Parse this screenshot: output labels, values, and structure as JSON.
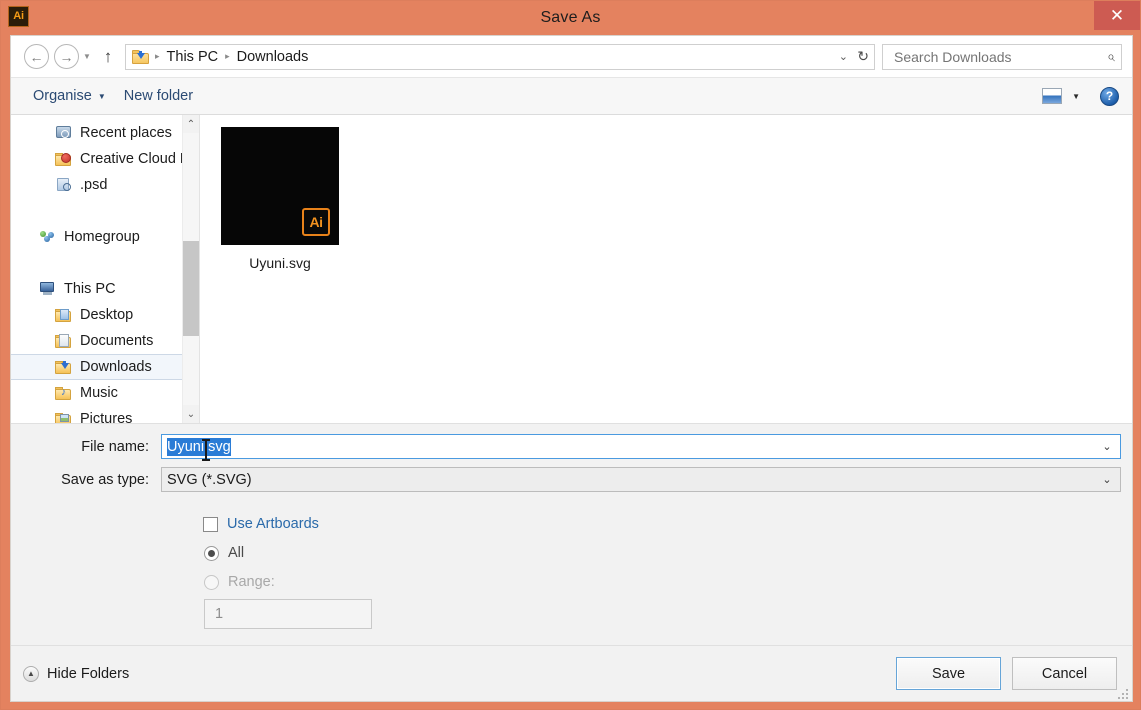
{
  "window": {
    "title": "Save As",
    "app_icon_label": "Ai",
    "close_label": "✕",
    "accent_color": "#e4825f",
    "close_button_color": "#cd5b52"
  },
  "navbar": {
    "back_icon": "←",
    "forward_icon": "→",
    "history_caret": "▼",
    "up_icon": "↑",
    "breadcrumb": {
      "items": [
        "This PC",
        "Downloads"
      ],
      "separator": "▸",
      "expand_caret": "⌄",
      "refresh_icon": "↻"
    },
    "search": {
      "placeholder": "Search Downloads",
      "value": "",
      "icon": "⌕"
    }
  },
  "command_bar": {
    "organise_label": "Organise",
    "organise_caret": "▼",
    "new_folder_label": "New folder",
    "view_caret": "▼",
    "help_label": "?"
  },
  "sidebar": {
    "items": [
      {
        "label": "Recent places",
        "icon": "recent-places-icon",
        "indent": true,
        "selected": false
      },
      {
        "label": "Creative Cloud File",
        "icon": "creative-cloud-files-icon",
        "indent": true,
        "selected": false
      },
      {
        "label": ".psd",
        "icon": "psd-search-icon",
        "indent": true,
        "selected": false
      },
      {
        "label": "Homegroup",
        "icon": "homegroup-icon",
        "indent": false,
        "selected": false
      },
      {
        "label": "This PC",
        "icon": "this-pc-icon",
        "indent": false,
        "selected": false
      },
      {
        "label": "Desktop",
        "icon": "desktop-folder-icon",
        "indent": true,
        "selected": false
      },
      {
        "label": "Documents",
        "icon": "documents-folder-icon",
        "indent": true,
        "selected": false
      },
      {
        "label": "Downloads",
        "icon": "downloads-folder-icon",
        "indent": true,
        "selected": true
      },
      {
        "label": "Music",
        "icon": "music-folder-icon",
        "indent": true,
        "selected": false
      },
      {
        "label": "Pictures",
        "icon": "pictures-folder-icon",
        "indent": true,
        "selected": false
      }
    ],
    "scrollbar": {
      "up_arrow": "⌃",
      "down_arrow": "⌄"
    }
  },
  "file_list": {
    "files": [
      {
        "name": "Uyuni.svg",
        "thumbnail_color": "#060606",
        "badge_label": "Ai",
        "badge_color": "#e8821a"
      }
    ]
  },
  "form": {
    "file_name": {
      "label": "File name:",
      "value": "Uyuni.svg",
      "selected": true,
      "caret": "⌄"
    },
    "save_as_type": {
      "label": "Save as type:",
      "value": "SVG (*.SVG)",
      "caret": "⌄"
    }
  },
  "options": {
    "use_artboards": {
      "label": "Use Artboards",
      "checked": false
    },
    "all": {
      "label": "All",
      "selected": true
    },
    "range": {
      "label": "Range:",
      "selected": false,
      "disabled": true,
      "value": "1"
    }
  },
  "footer": {
    "hide_folders_label": "Hide Folders",
    "hide_folders_icon": "▲",
    "save_label": "Save",
    "cancel_label": "Cancel"
  }
}
